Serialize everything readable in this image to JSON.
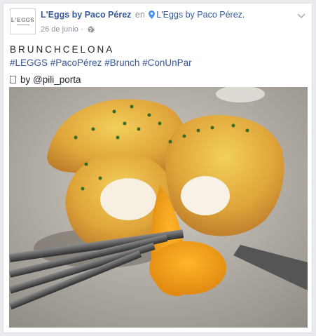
{
  "post": {
    "page_name": "L'Eggs by Paco Pérez",
    "in_text": "en",
    "location": "L'Eggs by Paco Pérez.",
    "date": "26 de junio",
    "heading": "BRUNCHCELONA",
    "hashtags": "#LEGGS #PacoPérez #Brunch #ConUnPar",
    "credit_prefix": "by",
    "credit_handle": "@pili_porta"
  },
  "avatar": {
    "logo_text": "L'EGGS"
  },
  "icons": {
    "location": "map-pin-icon",
    "privacy": "globe-icon",
    "menu": "chevron-down-icon",
    "credit": "camera-icon"
  },
  "colors": {
    "link": "#365899",
    "meta": "#90949c",
    "text": "#1d2129",
    "background": "#e9ebee"
  }
}
